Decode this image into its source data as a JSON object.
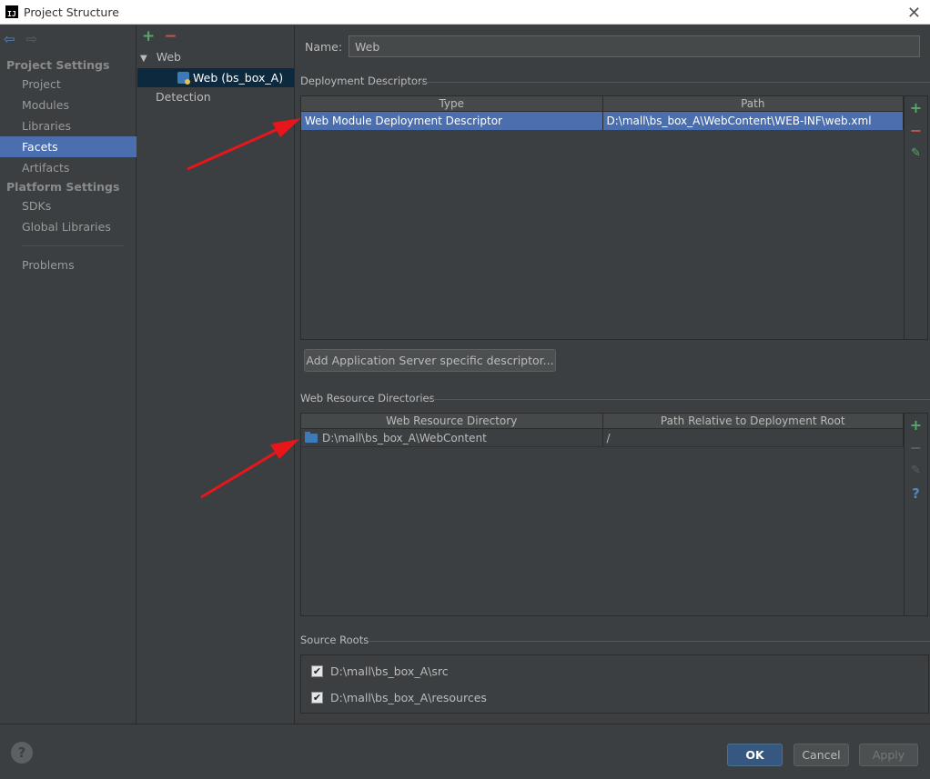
{
  "window": {
    "title": "Project Structure",
    "logo_text": "IJ"
  },
  "nav": {
    "sections": [
      {
        "label": "Project Settings",
        "items": [
          "Project",
          "Modules",
          "Libraries",
          "Facets",
          "Artifacts"
        ]
      },
      {
        "label": "Platform Settings",
        "items": [
          "SDKs",
          "Global Libraries"
        ]
      }
    ],
    "selected": "Facets",
    "problems": "Problems"
  },
  "tree": {
    "root": "Web",
    "child": "Web (bs_box_A)",
    "detection": "Detection"
  },
  "main": {
    "name_label": "Name:",
    "name_value": "Web",
    "deployment": {
      "title": "Deployment Descriptors",
      "columns": [
        "Type",
        "Path"
      ],
      "rows": [
        {
          "type": "Web Module Deployment Descriptor",
          "path": "D:\\mall\\bs_box_A\\WebContent\\WEB-INF\\web.xml"
        }
      ],
      "add_server_button": "Add Application Server specific descriptor..."
    },
    "web_resources": {
      "title": "Web Resource Directories",
      "columns": [
        "Web Resource Directory",
        "Path Relative to Deployment Root"
      ],
      "rows": [
        {
          "directory": "D:\\mall\\bs_box_A\\WebContent",
          "relative": "/"
        }
      ]
    },
    "source_roots": {
      "title": "Source Roots",
      "items": [
        {
          "path": "D:\\mall\\bs_box_A\\src",
          "checked": true
        },
        {
          "path": "D:\\mall\\bs_box_A\\resources",
          "checked": true
        }
      ]
    }
  },
  "footer": {
    "ok": "OK",
    "cancel": "Cancel",
    "apply": "Apply"
  },
  "colors": {
    "selection": "#4b6eaf",
    "annotation_arrow": "#e8161a",
    "add": "#59a869",
    "remove": "#c75450"
  }
}
